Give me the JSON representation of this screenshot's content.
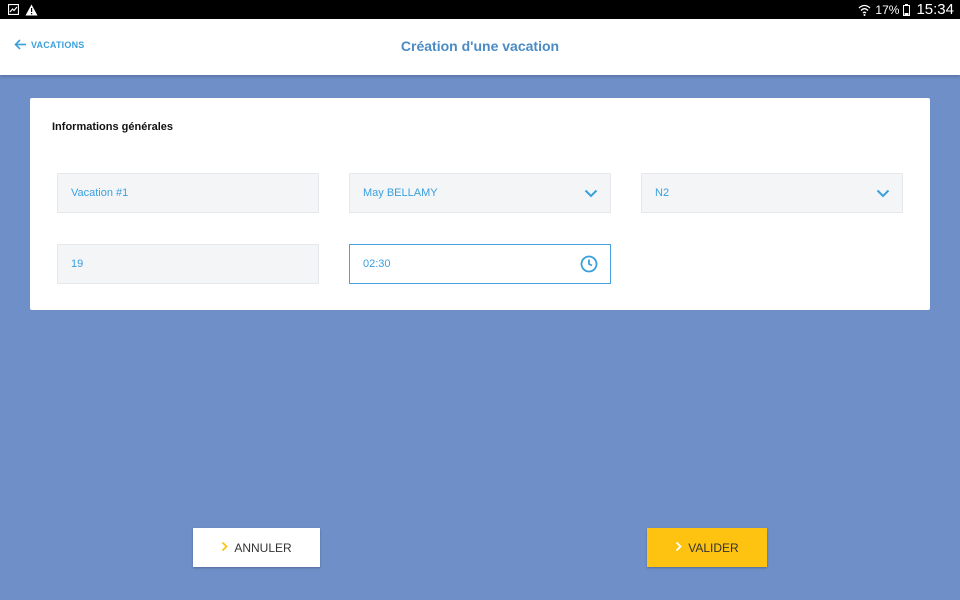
{
  "status_bar": {
    "battery": "17%",
    "time": "15:34",
    "icons": [
      "gallery-icon",
      "warning-icon",
      "wifi-icon",
      "battery-icon"
    ]
  },
  "header": {
    "back_label": "VACATIONS",
    "title": "Création d'une vacation"
  },
  "form": {
    "section_title": "Informations générales",
    "name_value": "Vacation #1",
    "person_value": "May BELLAMY",
    "level_value": "N2",
    "number_value": "19",
    "time_value": "02:30"
  },
  "actions": {
    "cancel_label": "ANNULER",
    "validate_label": "VALIDER"
  },
  "colors": {
    "background": "#6f8fc9",
    "accent_blue": "#3aa0dd",
    "title_blue": "#4a8bc4",
    "validate_yellow": "#fec310"
  }
}
